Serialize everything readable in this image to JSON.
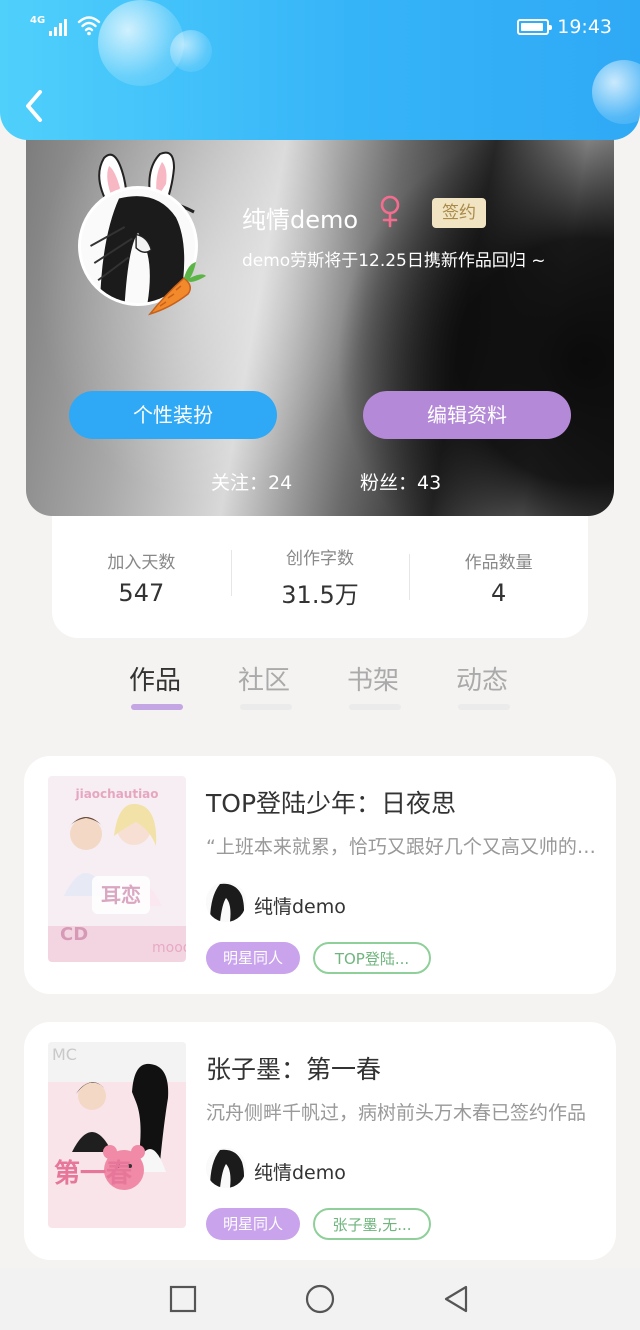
{
  "status_bar": {
    "network": "4G",
    "time": "19:43"
  },
  "profile": {
    "nickname": "纯情demo",
    "gender_icon": "female-symbol-icon",
    "badge": "签约",
    "bio": "demo劳斯将于12.25日携新作品回归 ~",
    "buttons": {
      "dress_up": "个性装扮",
      "edit_profile": "编辑资料"
    },
    "following": "关注：24",
    "followers": "粉丝：43"
  },
  "stats": [
    {
      "label": "加入天数",
      "value": "547"
    },
    {
      "label": "创作字数",
      "value": "31.5万"
    },
    {
      "label": "作品数量",
      "value": "4"
    }
  ],
  "tabs": [
    {
      "label": "作品",
      "active": true
    },
    {
      "label": "社区",
      "active": false
    },
    {
      "label": "书架",
      "active": false
    },
    {
      "label": "动态",
      "active": false
    }
  ],
  "works": [
    {
      "title": "TOP登陆少年：日夜思",
      "description": "“上班本来就累，恰巧又跟好几个又高又帅的男人在一起",
      "author": "纯情demo",
      "category": "明星同人",
      "keyword": "TOP登陆...",
      "cover_text": "jiaochautiao"
    },
    {
      "title": "张子墨：第一春",
      "description": "沉舟侧畔千帆过，病树前头万木春已签约作品",
      "author": "纯情demo",
      "category": "明星同人",
      "keyword": "张子墨,无...",
      "cover_text": "第一春"
    }
  ],
  "colors": {
    "header_blue": "#36b4f8",
    "dress_button": "#2fa8f6",
    "edit_button": "#b48ad8",
    "tab_indicator": "#c3a6e3",
    "category_tag": "#c9a3ec",
    "keyword_tag_border": "#8fcf9a"
  },
  "navigation": {
    "recent_icon": "square-icon",
    "home_icon": "circle-icon",
    "back_icon": "triangle-back-icon"
  }
}
